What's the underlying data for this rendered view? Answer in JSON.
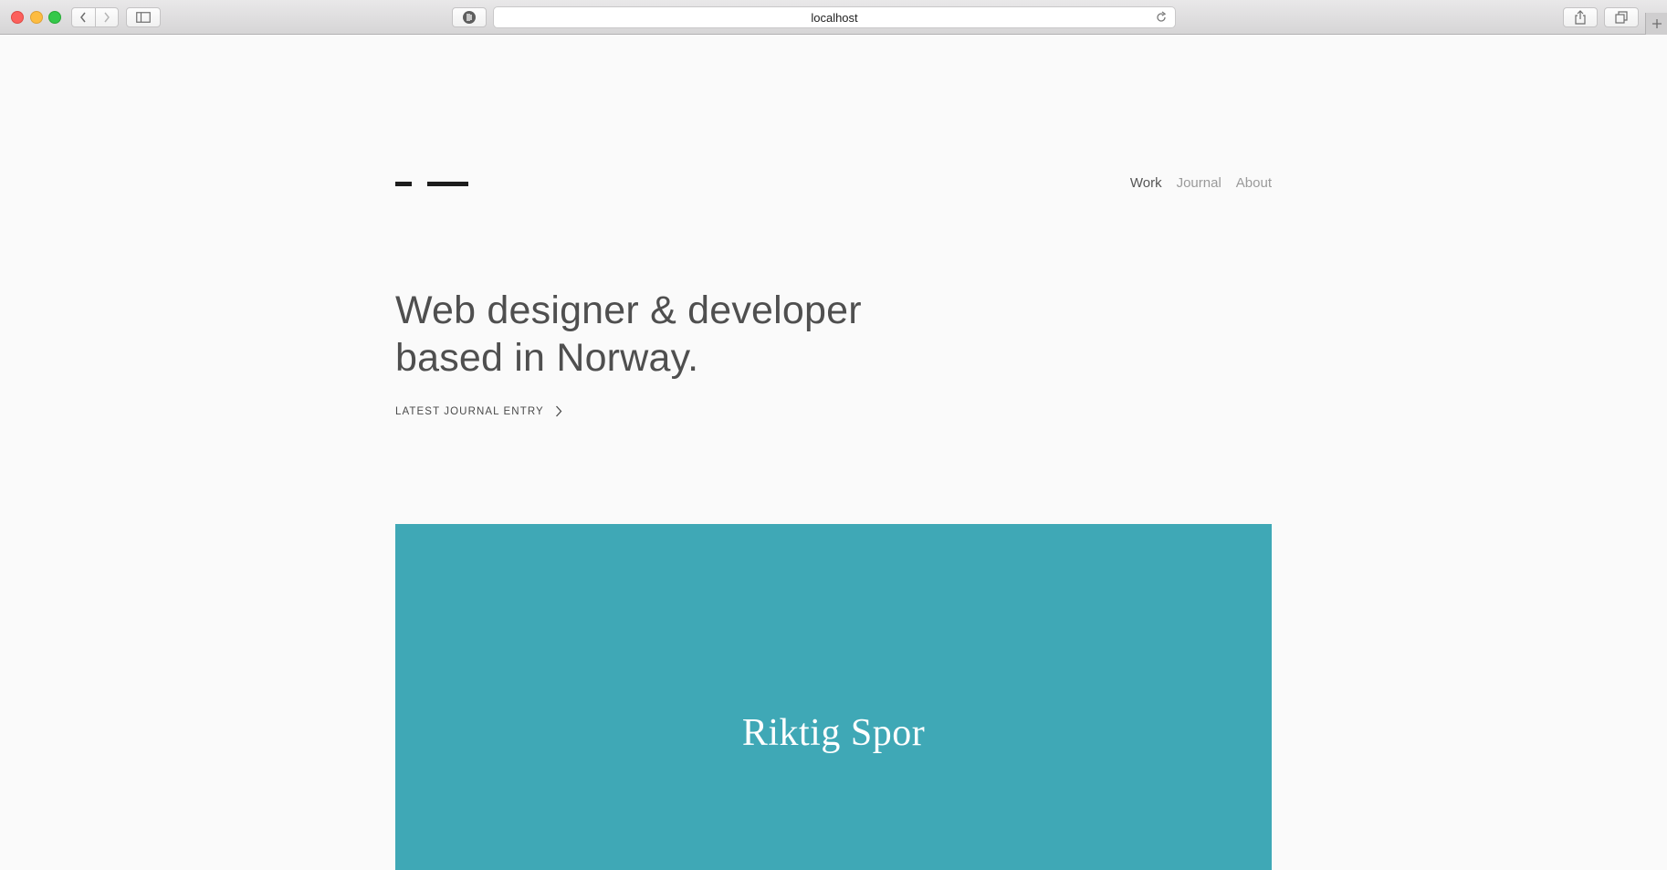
{
  "browser": {
    "url": "localhost",
    "icons": {
      "back": "chevron-left-icon",
      "forward": "chevron-right-icon",
      "sidebar": "sidebar-icon",
      "privacy": "privacy-shield-icon",
      "reload": "reload-icon",
      "share": "share-icon",
      "tabs": "tabs-icon",
      "new_tab": "plus-icon"
    }
  },
  "header": {
    "nav": [
      {
        "label": "Work",
        "active": true
      },
      {
        "label": "Journal",
        "active": false
      },
      {
        "label": "About",
        "active": false
      }
    ]
  },
  "hero": {
    "line1": "Web designer & developer",
    "line2": "based in Norway.",
    "link_label": "LATEST JOURNAL ENTRY",
    "link_icon": "chevron-right-icon"
  },
  "feature": {
    "title": "Riktig Spor",
    "background": "#3fa8b6"
  },
  "colors": {
    "page_background": "#fafafa",
    "text_primary": "#4f4f4f",
    "nav_inactive": "#9a9a9a",
    "logo": "#1d1d1d"
  }
}
